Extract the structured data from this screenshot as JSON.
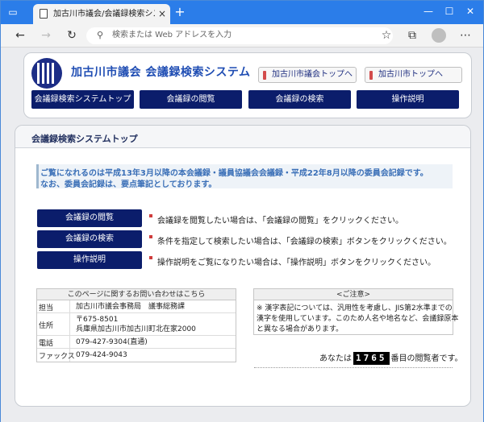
{
  "browser": {
    "tab_title": "加古川市議会/会議録検索システム",
    "tab_close": "×",
    "new_tab": "+",
    "address_placeholder": "検索または Web アドレスを入力",
    "win_min": "—",
    "win_max": "☐",
    "win_close": "✕"
  },
  "header": {
    "site_title": "加古川市議会 会議録検索システム",
    "links": [
      {
        "label": "加古川市議会トップへ"
      },
      {
        "label": "加古川市トップへ"
      }
    ],
    "nav": [
      {
        "label": "会議録検索システムトップ"
      },
      {
        "label": "会議録の閲覧"
      },
      {
        "label": "会議録の検索"
      },
      {
        "label": "操作説明"
      }
    ]
  },
  "main": {
    "title": "会議録検索システムトップ",
    "notice_lines": [
      "ご覧になれるのは平成13年3月以降の本会議録・議員協議会会議録・平成22年8月以降の委員会記録です。",
      "なお、委員会記録は、要点筆記としております。"
    ],
    "actions": [
      {
        "button": "会議録の閲覧",
        "desc": "会議録を閲覧したい場合は、「会議録の閲覧」をクリックください。"
      },
      {
        "button": "会議録の検索",
        "desc": "条件を指定して検索したい場合は、「会議録の検索」ボタンをクリックください。"
      },
      {
        "button": "操作説明",
        "desc": "操作説明をご覧になりたい場合は、「操作説明」ボタンをクリックください。"
      }
    ]
  },
  "contact": {
    "heading": "このページに関するお問い合わせはこちら",
    "rows": [
      {
        "key": "担当",
        "value": "加古川市議会事務局　議事総務課"
      },
      {
        "key": "住所",
        "value": "〒675-8501",
        "value2": "兵庫県加古川市加古川町北在家2000"
      },
      {
        "key": "電話",
        "value": "079-427-9304(直通)"
      },
      {
        "key": "ファックス",
        "value": "079-424-9043"
      }
    ]
  },
  "caution": {
    "heading": "<ご注意>",
    "lines": [
      "※ 漢字表記については、汎用性を考慮し、JIS第2水準までの",
      "漢字を使用しています。このため人名や地名など、会議録原本",
      "と異なる場合があります。"
    ]
  },
  "counter": {
    "prefix": "あなたは",
    "digits": "1765",
    "suffix": "番目の閲覧者です。"
  },
  "colors": {
    "browser_accent": "#2b7de9",
    "nav_button": "#0b1d6b",
    "title_blue": "#1f4db3",
    "notice_blue": "#3a6fb7"
  }
}
